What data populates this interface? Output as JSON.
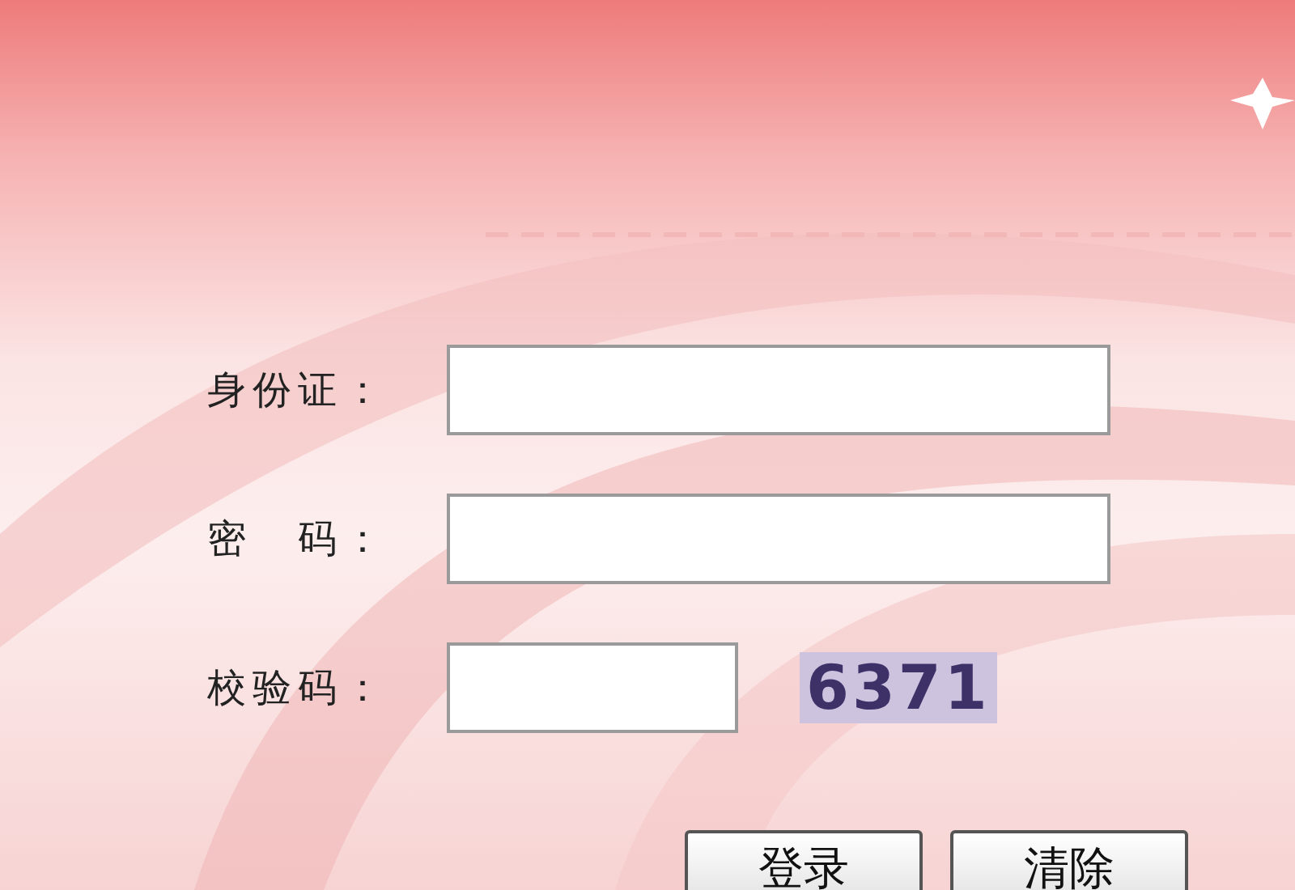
{
  "form": {
    "fields": [
      {
        "kind": "text",
        "label": "身份证："
      },
      {
        "kind": "password",
        "label": "密　码："
      },
      {
        "kind": "captcha",
        "label": "校验码：",
        "captcha": "6371"
      }
    ],
    "buttons": [
      "登录",
      "清除"
    ]
  }
}
